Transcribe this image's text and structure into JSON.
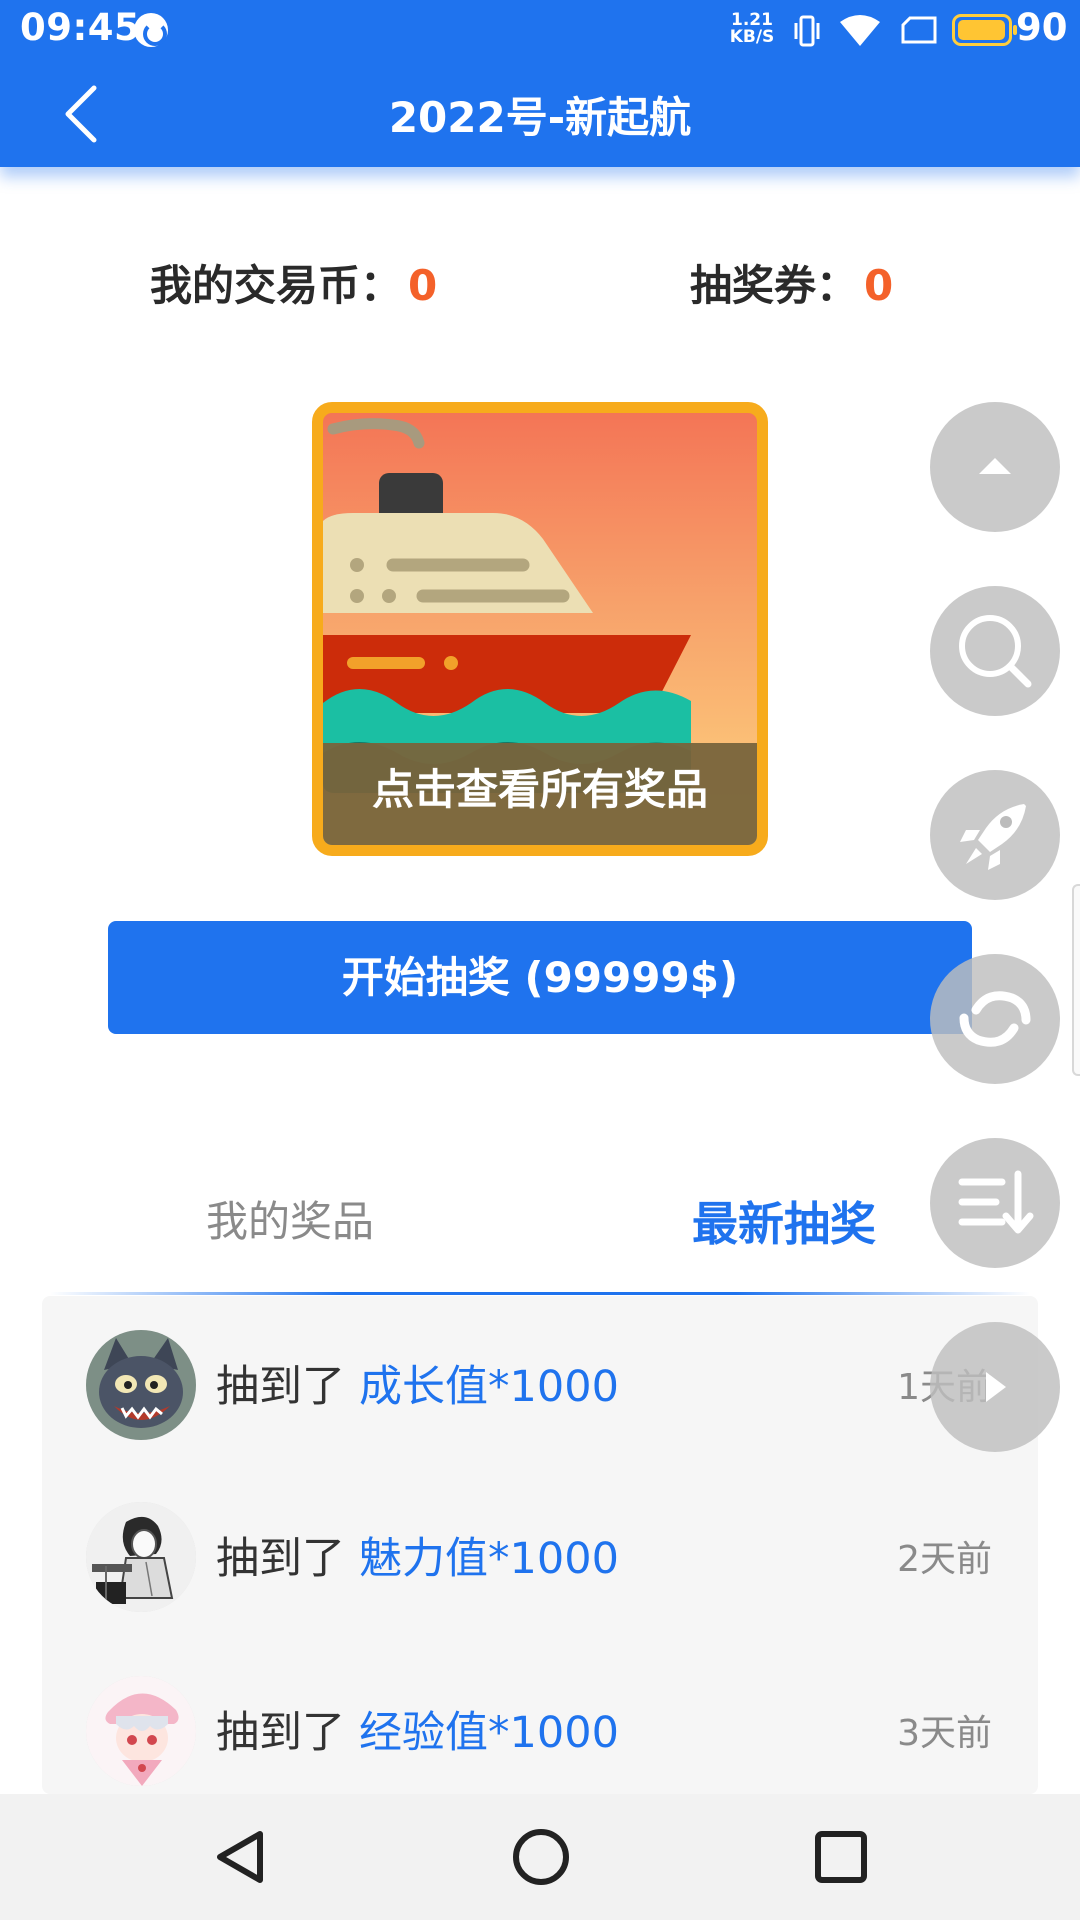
{
  "status_bar": {
    "time": "09:45",
    "speed_value": "1.21",
    "speed_unit": "KB/S",
    "battery_percent": "90",
    "icons": [
      "app-notification-icon",
      "vibrate-icon",
      "wifi-icon",
      "sim-icon",
      "battery-icon"
    ]
  },
  "header": {
    "title": "2022号-新起航",
    "back_icon": "chevron-left-icon"
  },
  "balance": {
    "coins_label": "我的交易币：",
    "coins_value": "0",
    "tickets_label": "抽奖券：",
    "tickets_value": "0"
  },
  "prize_card": {
    "overlay_text": "点击查看所有奖品",
    "image": "cruise-ship-illustration"
  },
  "start_button": {
    "label": "开始抽奖 (99999$)"
  },
  "tabs": [
    {
      "label": "我的奖品",
      "active": false
    },
    {
      "label": "最新抽奖",
      "active": true
    }
  ],
  "records": [
    {
      "prefix": "抽到了",
      "prize": "成长值*1000",
      "time": "1天前"
    },
    {
      "prefix": "抽到了",
      "prize": "魅力值*1000",
      "time": "2天前"
    },
    {
      "prefix": "抽到了",
      "prize": "经验值*1000",
      "time": "3天前"
    }
  ],
  "floating_buttons": [
    "scroll-top-icon",
    "search-icon",
    "rocket-icon",
    "refresh-icon",
    "sort-icon",
    "play-icon"
  ],
  "nav_bar": [
    "back-triangle-icon",
    "home-circle-icon",
    "recents-square-icon"
  ],
  "colors": {
    "primary": "#1f73ee",
    "highlight_number": "#f4612a",
    "card_border": "#f7ab1c",
    "list_background": "#f6f6f6"
  }
}
